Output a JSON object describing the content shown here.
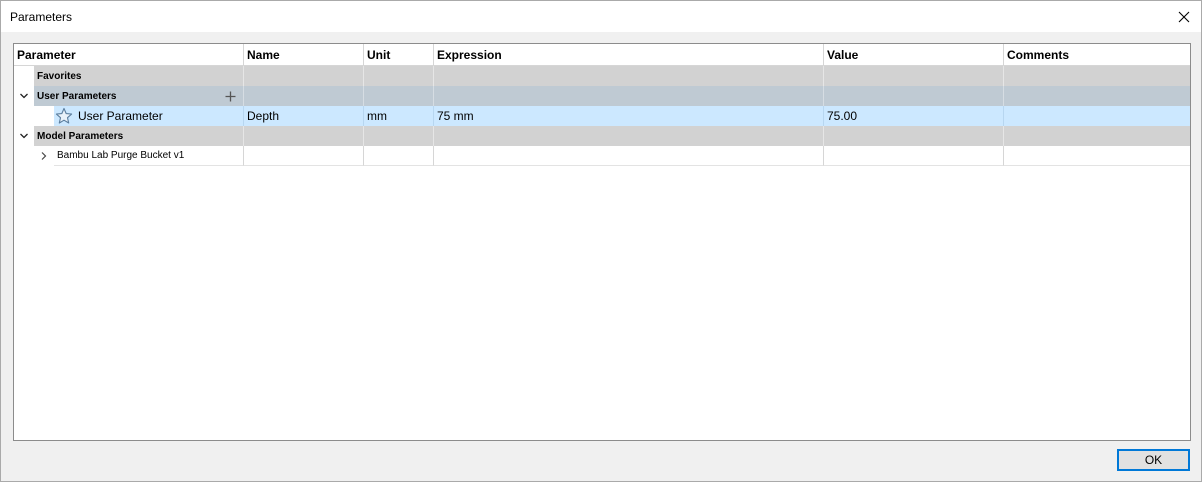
{
  "window": {
    "title": "Parameters"
  },
  "columns": [
    {
      "label": "Parameter"
    },
    {
      "label": "Name"
    },
    {
      "label": "Unit"
    },
    {
      "label": "Expression"
    },
    {
      "label": "Value"
    },
    {
      "label": "Comments"
    }
  ],
  "groups": {
    "favorites": {
      "label": "Favorites"
    },
    "user_parameters": {
      "label": "User Parameters",
      "expanded": true
    },
    "model_parameters": {
      "label": "Model Parameters",
      "expanded": true
    }
  },
  "user_parameter_row": {
    "parameter": "User Parameter",
    "name": "Depth",
    "unit": "mm",
    "expression": "75 mm",
    "value": "75.00",
    "comments": ""
  },
  "model_row": {
    "parameter": "Bambu Lab Purge Bucket v1",
    "expanded": false
  },
  "buttons": {
    "ok": "OK"
  },
  "colors": {
    "selected_row": "#cce8ff",
    "group_gray": "#d2d2d2",
    "group_blue": "#bfcad3",
    "accent": "#0078d7"
  },
  "icons": {
    "close": "close-icon",
    "expand": "chevron-down-icon",
    "collapse": "chevron-right-icon",
    "add": "plus-icon",
    "favorite": "star-icon"
  }
}
